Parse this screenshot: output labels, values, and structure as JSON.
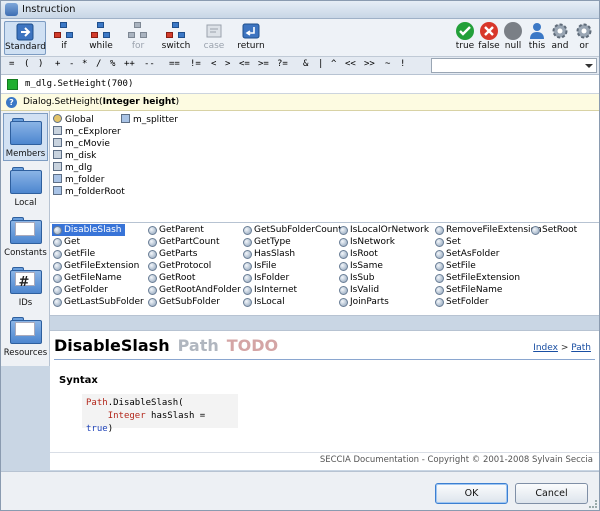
{
  "window": {
    "title": "Instruction"
  },
  "toolbar": {
    "left": [
      {
        "label": "Standard",
        "state": "active"
      },
      {
        "label": "if",
        "state": "normal"
      },
      {
        "label": "while",
        "state": "normal"
      },
      {
        "label": "for",
        "state": "disabled"
      },
      {
        "label": "switch",
        "state": "normal"
      },
      {
        "label": "case",
        "state": "disabled"
      },
      {
        "label": "return",
        "state": "normal"
      }
    ],
    "right": [
      {
        "label": "true",
        "icon": "check-icon",
        "color": "#23a03a"
      },
      {
        "label": "false",
        "icon": "cross-icon",
        "color": "#d8372b"
      },
      {
        "label": "null",
        "icon": "null-icon",
        "color": "#7a7f86"
      },
      {
        "label": "this",
        "icon": "user-icon",
        "color": "#3b78c6"
      },
      {
        "label": "and",
        "icon": "gear-icon",
        "color": "#8a96a4"
      },
      {
        "label": "or",
        "icon": "gear-icon",
        "color": "#8a96a4"
      }
    ]
  },
  "operators": [
    "=",
    "(",
    ")",
    "+",
    "-",
    "*",
    "/",
    "%",
    "++",
    "--",
    "==",
    "!=",
    "<",
    ">",
    "<=",
    ">=",
    "?=",
    "&",
    "|",
    "^",
    "<<",
    ">>",
    "~",
    "!"
  ],
  "expression": {
    "text": "m_dlg.SetHeight(700)"
  },
  "hint": {
    "prefix": "Dialog.SetHeight(",
    "bold": "Integer height",
    "suffix": ")"
  },
  "sidebar": [
    {
      "label": "Members",
      "state": "active"
    },
    {
      "label": "Local",
      "state": "normal"
    },
    {
      "label": "Constants",
      "state": "normal"
    },
    {
      "label": "IDs",
      "state": "normal"
    },
    {
      "label": "Resources",
      "state": "normal"
    }
  ],
  "members": {
    "col1": [
      "Global",
      "m_cExplorer",
      "m_cMovie",
      "m_disk",
      "m_dlg",
      "m_folder",
      "m_folderRoot"
    ],
    "col2": [
      "m_splitter"
    ]
  },
  "functions": {
    "selected": "DisableSlash",
    "columns": [
      [
        "DisableSlash",
        "Get",
        "GetFile",
        "GetFileExtension",
        "GetFileName",
        "GetFolder",
        "GetLastSubFolder"
      ],
      [
        "GetParent",
        "GetPartCount",
        "GetParts",
        "GetProtocol",
        "GetRoot",
        "GetRootAndFolder",
        "GetSubFolder"
      ],
      [
        "GetSubFolderCount",
        "GetType",
        "HasSlash",
        "IsFile",
        "IsFolder",
        "IsInternet",
        "IsLocal"
      ],
      [
        "IsLocalOrNetwork",
        "IsNetwork",
        "IsRoot",
        "IsSame",
        "IsSub",
        "IsValid",
        "JoinParts"
      ],
      [
        "RemoveFileExtension",
        "Set",
        "SetAsFolder",
        "SetFile",
        "SetFileExtension",
        "SetFileName",
        "SetFolder"
      ],
      [
        "SetRoot"
      ]
    ]
  },
  "doc": {
    "title": "DisableSlash",
    "path": "Path",
    "todo": "TODO",
    "nav_index": "Index",
    "nav_sep": " > ",
    "nav_path": "Path",
    "syntax_heading": "Syntax",
    "code_line1_kw": "Path",
    "code_line1_rest": ".DisableSlash(",
    "code_line2_type": "Integer",
    "code_line2_mid": " hasSlash = ",
    "code_line2_val": "true",
    "code_line2_end": ")",
    "copyright": "SECCIA Documentation - Copyright © 2001-2008 Sylvain Seccia"
  },
  "buttons": {
    "ok": "OK",
    "cancel": "Cancel"
  }
}
